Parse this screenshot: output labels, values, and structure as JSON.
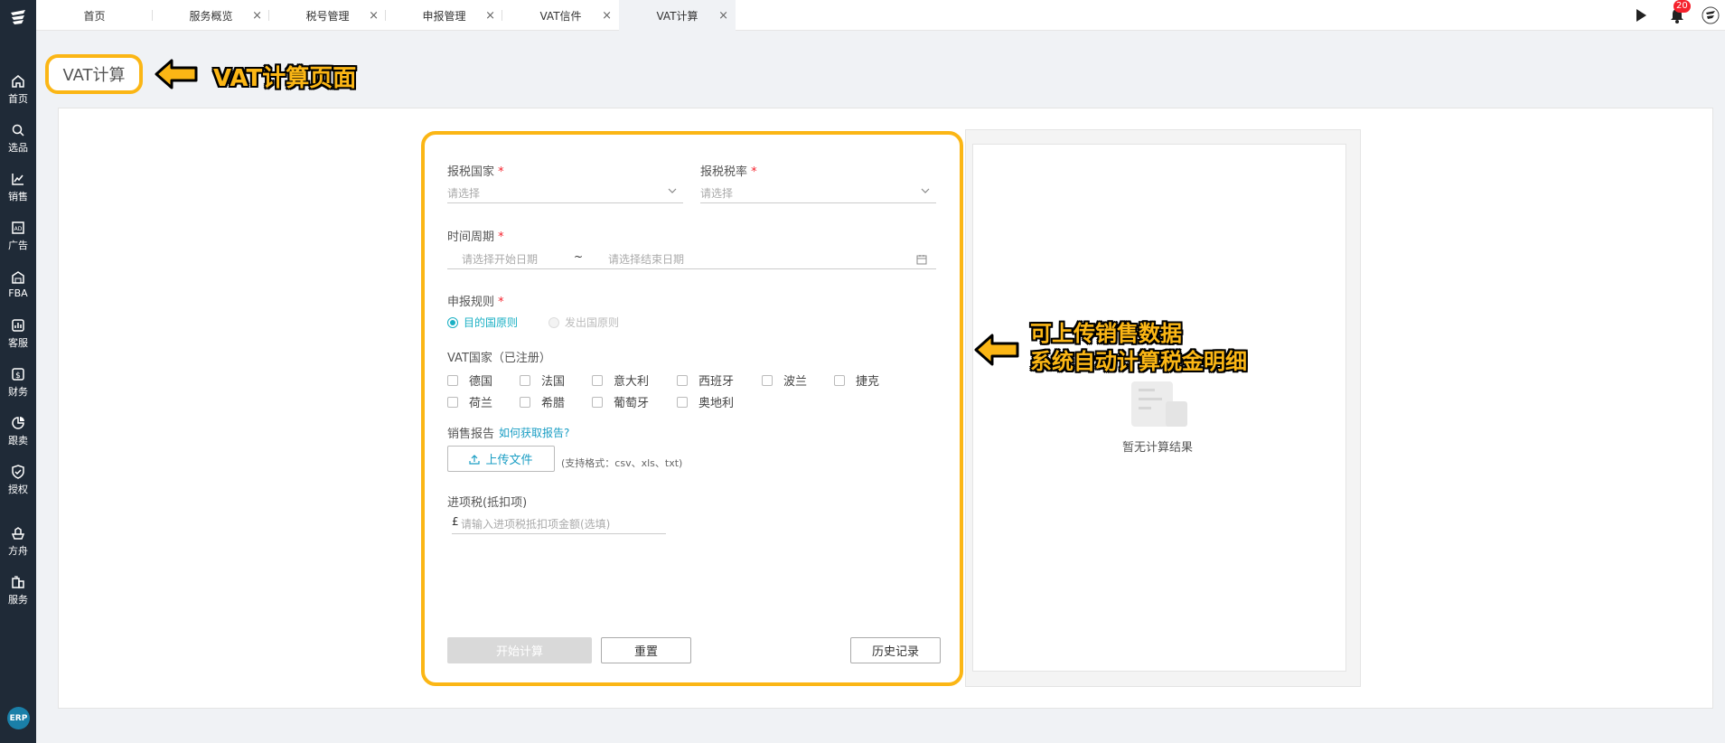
{
  "tabs": [
    {
      "label": "首页",
      "closable": false
    },
    {
      "label": "服务概览",
      "closable": true
    },
    {
      "label": "税号管理",
      "closable": true
    },
    {
      "label": "申报管理",
      "closable": true
    },
    {
      "label": "VAT信件",
      "closable": true
    },
    {
      "label": "VAT计算",
      "closable": true,
      "active": true
    }
  ],
  "tab_close_glyph": "×",
  "notifications": {
    "count": "20"
  },
  "sidebar": {
    "items": [
      {
        "label": "首页",
        "icon": "home-icon"
      },
      {
        "label": "选品",
        "icon": "search-icon"
      },
      {
        "label": "销售",
        "icon": "chart-icon"
      },
      {
        "label": "广告",
        "icon": "ad-icon"
      },
      {
        "label": "FBA",
        "icon": "warehouse-icon"
      },
      {
        "label": "客服",
        "icon": "service-icon"
      },
      {
        "label": "财务",
        "icon": "finance-icon"
      },
      {
        "label": "跟卖",
        "icon": "pie-icon"
      },
      {
        "label": "授权",
        "icon": "shield-icon"
      },
      {
        "label": "方舟",
        "icon": "ark-icon"
      },
      {
        "label": "服务",
        "icon": "building-icon"
      }
    ],
    "erp_badge": "ERP"
  },
  "page": {
    "title": "VAT计算",
    "annotation_title": "VAT计算页面",
    "annotation_result_line1": "可上传销售数据",
    "annotation_result_line2": "系统自动计算税金明细"
  },
  "form": {
    "country_label": "报税国家",
    "country_placeholder": "请选择",
    "rate_label": "报税税率",
    "rate_placeholder": "请选择",
    "period_label": "时间周期",
    "start_placeholder": "请选择开始日期",
    "range_sep": "~",
    "end_placeholder": "请选择结束日期",
    "rule_label": "申报规则",
    "rule_option_dest": "目的国原则",
    "rule_option_origin": "发出国原则",
    "required_mark": "*",
    "vat_countries_label": "VAT国家（已注册）",
    "vat_countries": [
      "德国",
      "法国",
      "意大利",
      "西班牙",
      "波兰",
      "捷克",
      "荷兰",
      "希腊",
      "葡萄牙",
      "奥地利"
    ],
    "sales_report_label": "销售报告",
    "how_to_get_link": "如何获取报告?",
    "upload_button": "上传文件",
    "upload_hint": "(支持格式：csv、xls、txt)",
    "input_tax_label": "进项税(抵扣项)",
    "currency_symbol": "£",
    "input_tax_placeholder": "请输入进项税抵扣项金额(选填)",
    "start_button": "开始计算",
    "reset_button": "重置",
    "history_button": "历史记录"
  },
  "result": {
    "empty_text": "暂无计算结果"
  },
  "colors": {
    "accent": "#1ab0c4",
    "annotation": "#fbb615",
    "sidebar": "#1f2a37"
  }
}
